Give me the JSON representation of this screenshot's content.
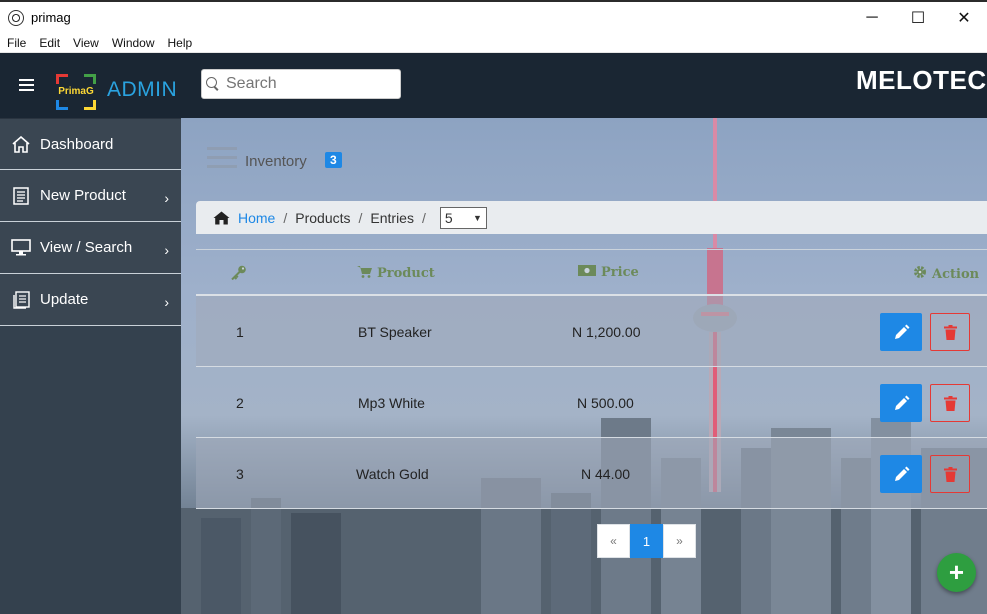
{
  "window": {
    "title": "primag",
    "minimize": "─",
    "maximize": "☐",
    "close": "✕"
  },
  "menubar": [
    "File",
    "Edit",
    "View",
    "Window",
    "Help"
  ],
  "header": {
    "logo_text": "PrimaG",
    "admin_label": "ADMIN",
    "search_placeholder": "Search",
    "brand": "MELOTECH"
  },
  "sidebar": {
    "items": [
      {
        "label": "Dashboard",
        "icon": "home-icon",
        "has_chevron": false
      },
      {
        "label": "New Product",
        "icon": "document-icon",
        "has_chevron": true
      },
      {
        "label": "View / Search",
        "icon": "monitor-icon",
        "has_chevron": true
      },
      {
        "label": "Update",
        "icon": "documents-icon",
        "has_chevron": true
      }
    ],
    "chevron": "›"
  },
  "inventory": {
    "title": "Inventory",
    "count": "3"
  },
  "breadcrumb": {
    "home": "Home",
    "sep": "/",
    "products": "Products",
    "entries": "Entries",
    "entries_value": "5"
  },
  "table": {
    "headers": {
      "id_icon": "key-icon",
      "product": "Product",
      "price": "Price",
      "action": "Action"
    },
    "rows": [
      {
        "id": "1",
        "product": "BT Speaker",
        "price": "N 1,200.00"
      },
      {
        "id": "2",
        "product": "Mp3 White",
        "price": "N 500.00"
      },
      {
        "id": "3",
        "product": "Watch Gold",
        "price": "N 44.00"
      }
    ]
  },
  "pagination": {
    "prev": "«",
    "current": "1",
    "next": "»"
  },
  "fab": "+",
  "colors": {
    "topbar": "#1a2633",
    "sidebar": "#34414e",
    "accent": "#1e88e5",
    "danger": "#e53935",
    "success": "#2e9e40",
    "header_text": "#6c8a5a"
  }
}
